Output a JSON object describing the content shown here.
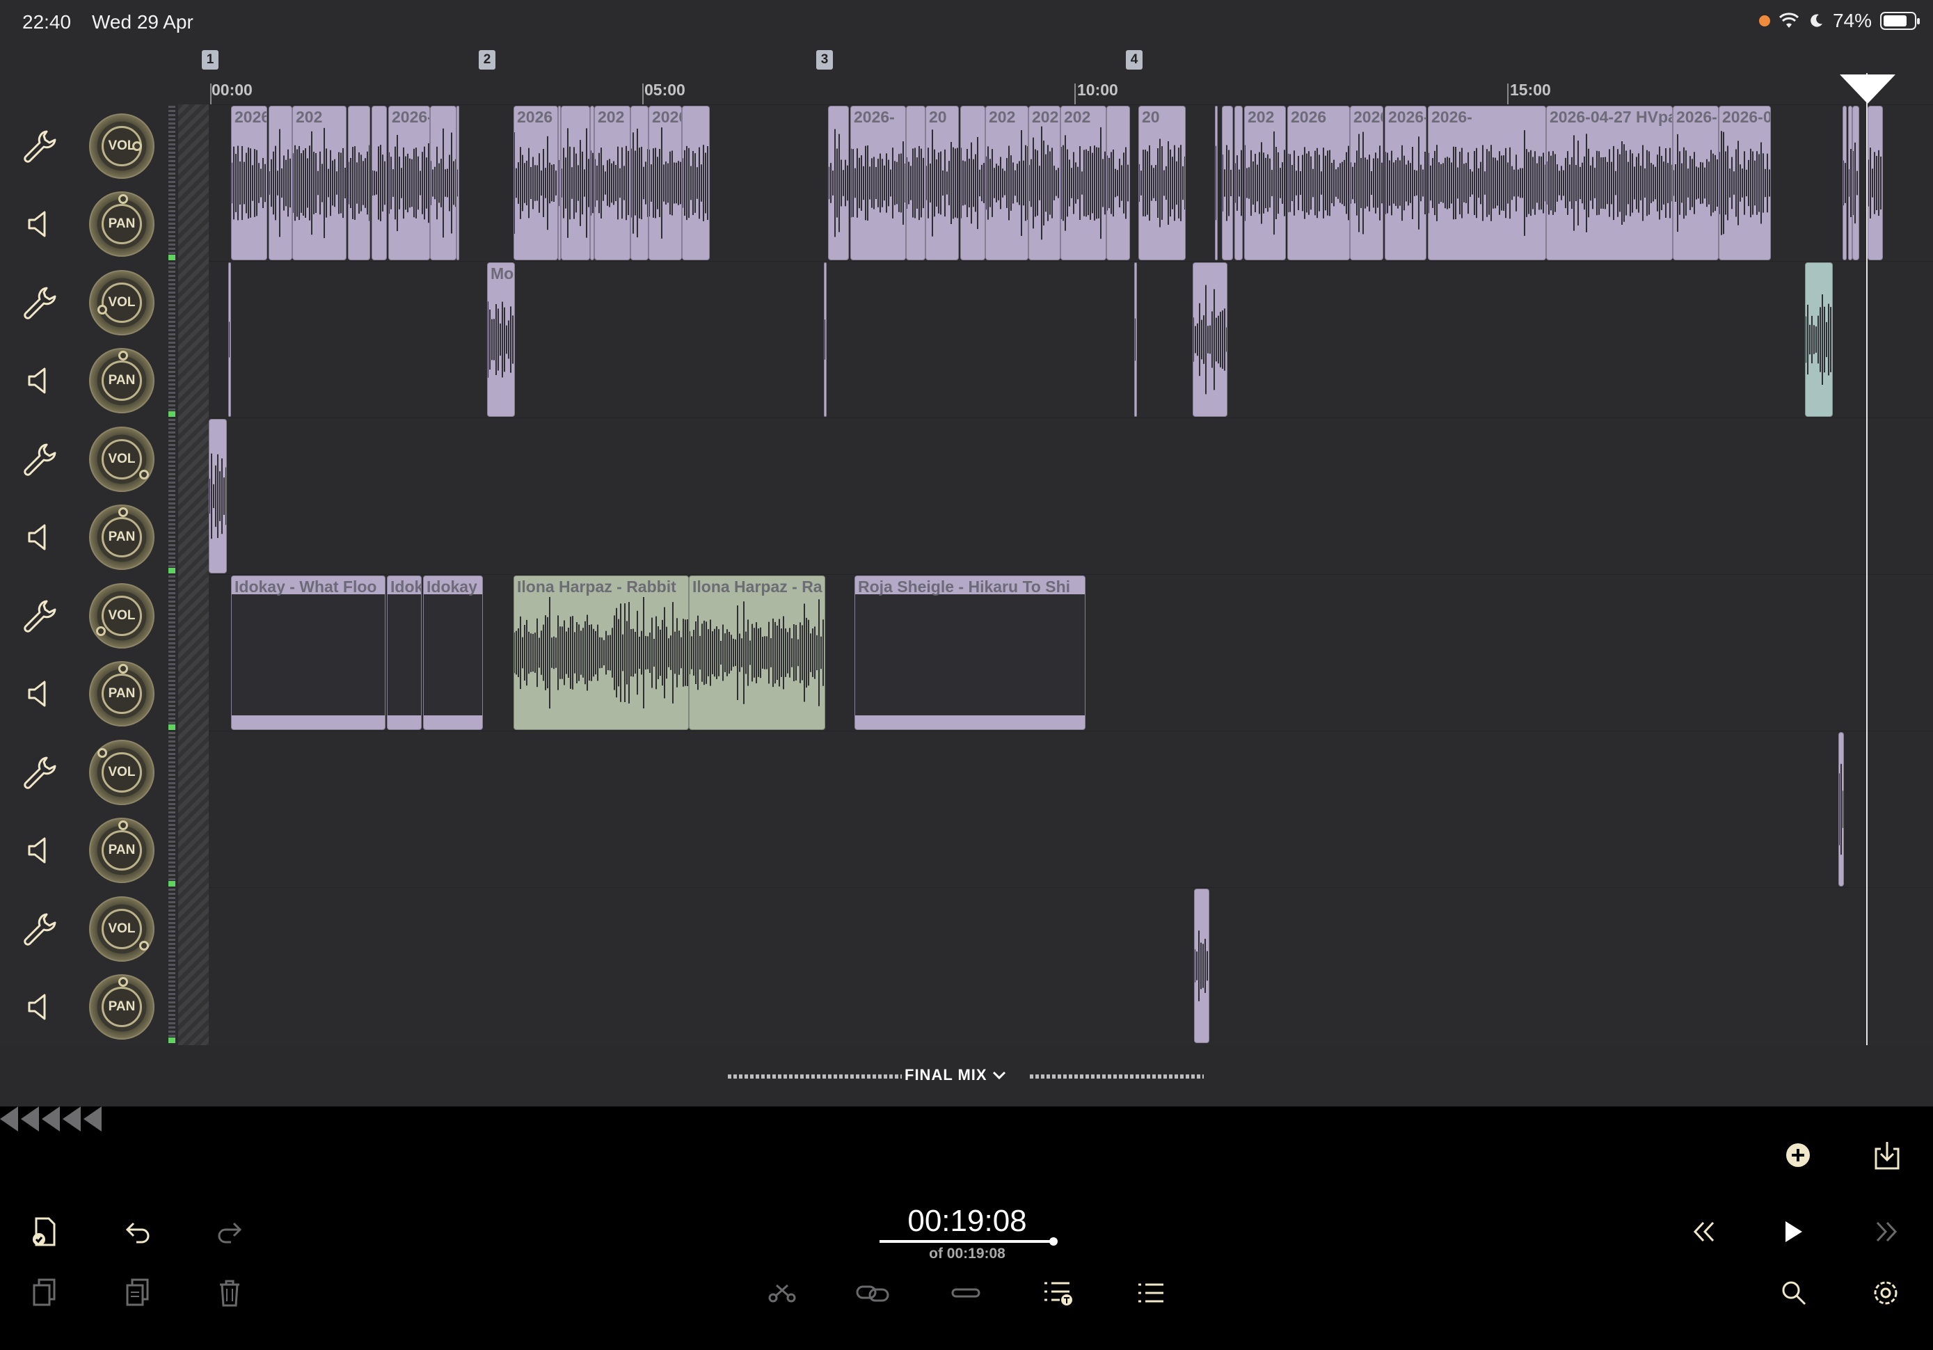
{
  "status_bar": {
    "time": "22:40",
    "date": "Wed 29 Apr",
    "battery": "74%",
    "battery_level": 0.74
  },
  "markers": [
    "1",
    "2",
    "3",
    "4"
  ],
  "ruler": {
    "labels": [
      "00:00",
      "05:00",
      "10:00",
      "15:00"
    ]
  },
  "tracks": [
    {
      "vol_label": "VOL",
      "pan_label": "PAN"
    },
    {
      "vol_label": "VOL",
      "pan_label": "PAN"
    },
    {
      "vol_label": "VOL",
      "pan_label": "PAN"
    },
    {
      "vol_label": "VOL",
      "pan_label": "PAN"
    },
    {
      "vol_label": "VOL",
      "pan_label": "PAN"
    },
    {
      "vol_label": "VOL",
      "pan_label": "PAN"
    }
  ],
  "clips": {
    "track1": [
      "2026-",
      "202",
      "2026-",
      "2026",
      "202",
      "2026-",
      "2026-",
      "20",
      "202",
      "202",
      "202",
      "20",
      "202",
      "2026",
      "2026",
      "2026-",
      "2026-",
      "2026-04-27 HVpa",
      "2026-04-27 HVp",
      "2026-0",
      "2026-0"
    ],
    "track2": [
      "Mo"
    ],
    "track4": [
      "Idokay - What Floo",
      "Idokay",
      "Idokay",
      "Ilona Harpaz - Rabbit",
      "Ilona Harpaz - Ra",
      "Roja Sheigle - Hikaru To Shi"
    ]
  },
  "mix": {
    "label": "FINAL MIX"
  },
  "transport": {
    "current_time": "00:19:08",
    "total_time": "of 00:19:08"
  },
  "colors": {
    "background": "#2b2b2d",
    "clip_purple": "#b4aac8",
    "clip_green": "#adb8a3",
    "knob_accent": "#bdb38a",
    "playhead": "#ffffff"
  },
  "icons": {
    "toolbar_left": [
      "file-check-icon",
      "undo-icon",
      "redo-icon",
      "cut-copy-icon",
      "paste-icon",
      "trash-icon"
    ],
    "toolbar_center": [
      "scissors-icon",
      "link-icon",
      "split-icon",
      "numbered-list-text-icon",
      "numbered-list-icon"
    ],
    "toolbar_right": [
      "add-icon",
      "export-icon",
      "rewind-icon",
      "play-icon",
      "fast-forward-icon",
      "search-icon",
      "settings-icon"
    ]
  }
}
